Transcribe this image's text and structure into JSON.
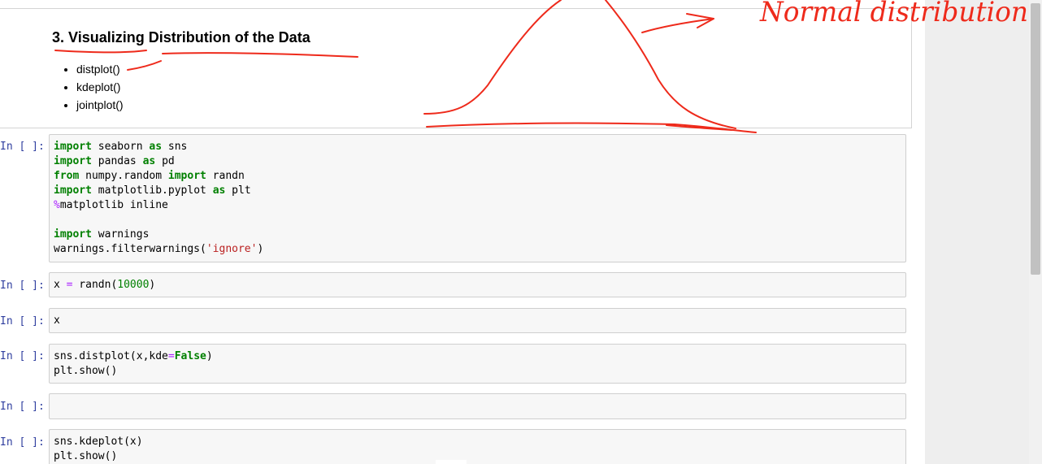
{
  "markdown": {
    "title": "3. Visualizing Distribution of the Data",
    "items": [
      "distplot()",
      "kdeplot()",
      "jointplot()"
    ]
  },
  "cells": [
    {
      "prompt": "In [ ]:",
      "lines": [
        [
          {
            "t": "import",
            "c": "kw"
          },
          {
            "t": " seaborn "
          },
          {
            "t": "as",
            "c": "kw"
          },
          {
            "t": " sns"
          }
        ],
        [
          {
            "t": "import",
            "c": "kw"
          },
          {
            "t": " pandas "
          },
          {
            "t": "as",
            "c": "kw"
          },
          {
            "t": " pd"
          }
        ],
        [
          {
            "t": "from",
            "c": "kw"
          },
          {
            "t": " numpy.random "
          },
          {
            "t": "import",
            "c": "kw"
          },
          {
            "t": " randn"
          }
        ],
        [
          {
            "t": "import",
            "c": "kw"
          },
          {
            "t": " matplotlib.pyplot "
          },
          {
            "t": "as",
            "c": "kw"
          },
          {
            "t": " plt"
          }
        ],
        [
          {
            "t": "%",
            "c": "op"
          },
          {
            "t": "matplotlib inline"
          }
        ],
        [],
        [
          {
            "t": "import",
            "c": "kw"
          },
          {
            "t": " warnings"
          }
        ],
        [
          {
            "t": "warnings.filterwarnings("
          },
          {
            "t": "'ignore'",
            "c": "str"
          },
          {
            "t": ")"
          }
        ]
      ]
    },
    {
      "prompt": "In [ ]:",
      "lines": [
        [
          {
            "t": "x "
          },
          {
            "t": "=",
            "c": "op"
          },
          {
            "t": " randn("
          },
          {
            "t": "10000",
            "c": "num"
          },
          {
            "t": ")"
          }
        ]
      ]
    },
    {
      "prompt": "In [ ]:",
      "lines": [
        [
          {
            "t": "x"
          }
        ]
      ]
    },
    {
      "prompt": "In [ ]:",
      "lines": [
        [
          {
            "t": "sns.distplot(x,kde"
          },
          {
            "t": "=",
            "c": "op"
          },
          {
            "t": "False",
            "c": "kw"
          },
          {
            "t": ")"
          }
        ],
        [
          {
            "t": "plt.show()"
          }
        ]
      ]
    },
    {
      "prompt": "In [ ]:",
      "lines": []
    },
    {
      "prompt": "In [ ]:",
      "lines": [
        [
          {
            "t": "sns.kdeplot(x)"
          }
        ],
        [
          {
            "t": "plt.show()"
          }
        ]
      ]
    }
  ],
  "annotation": {
    "handwritten_text": "Normal distribution",
    "ink_color": "#ee2a1b"
  },
  "colors": {
    "prompt": "#303f9f",
    "keyword": "#008000",
    "string": "#ba2121",
    "operator": "#aa22ff",
    "number": "#008000"
  }
}
